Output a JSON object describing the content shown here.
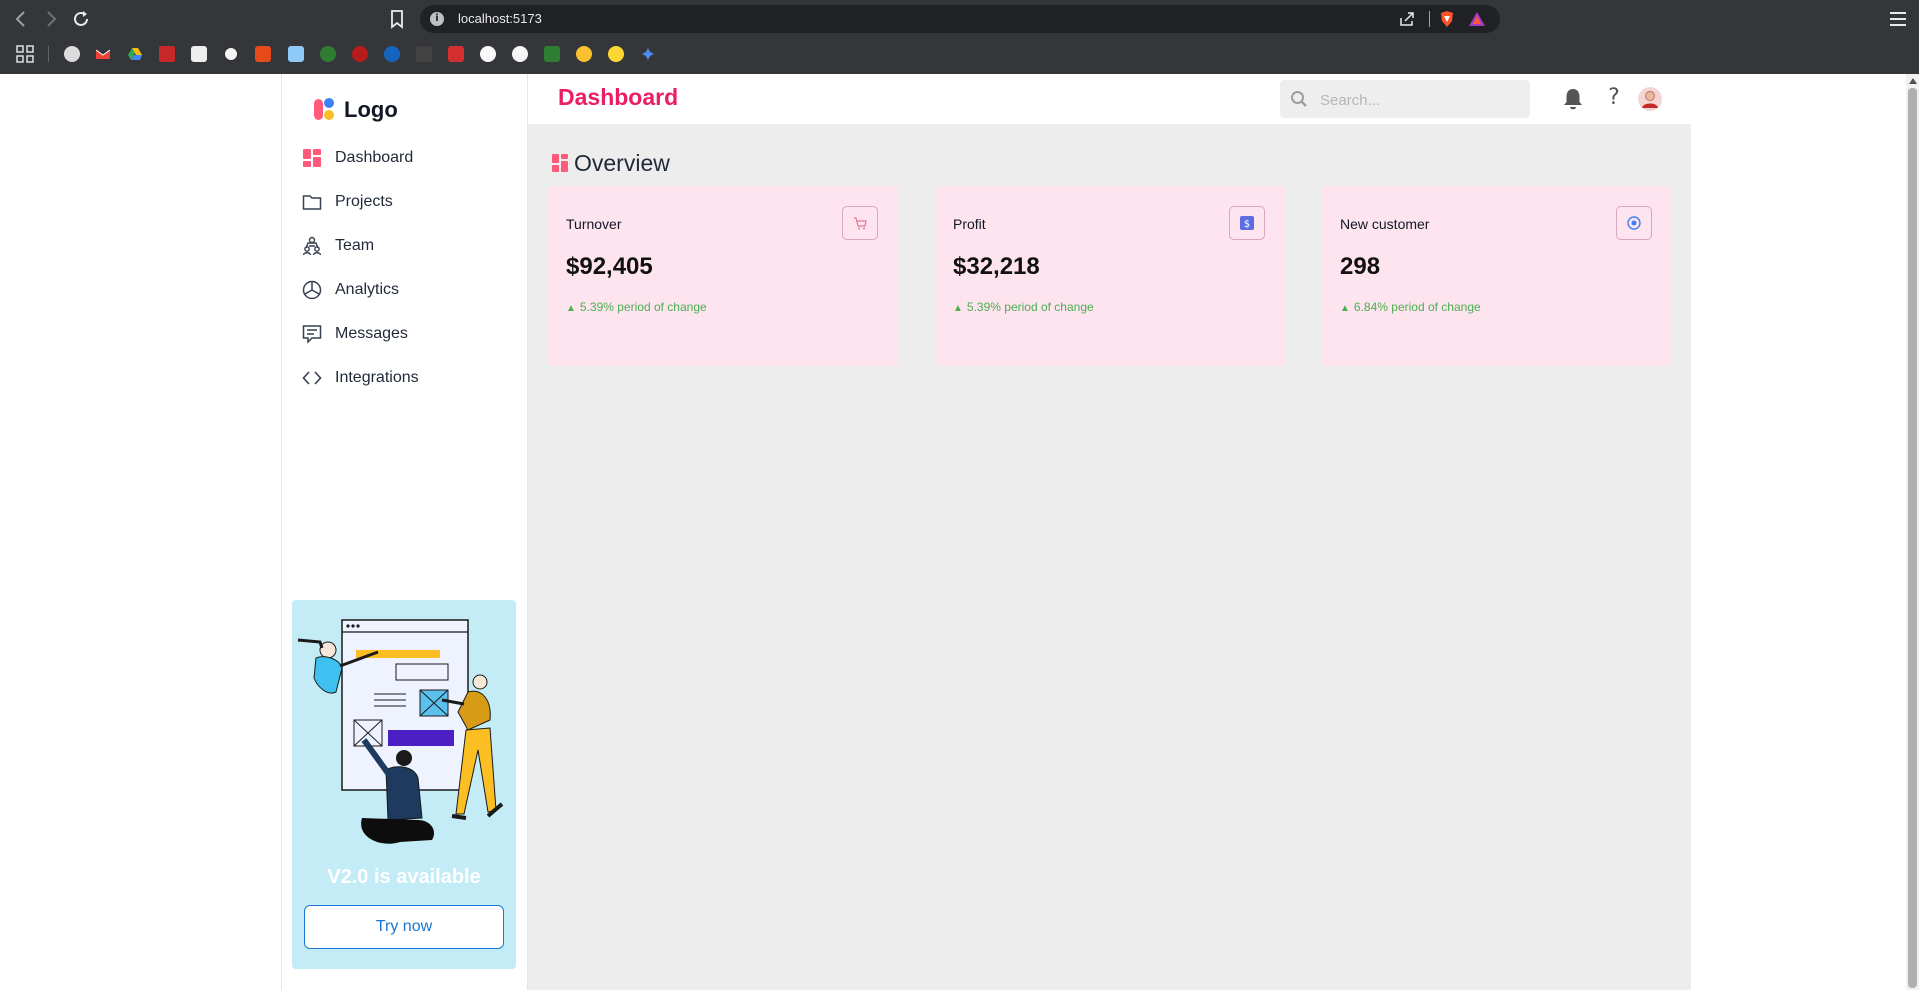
{
  "browser": {
    "url": "localhost:5173",
    "back_icon": "chevron-left-icon",
    "forward_icon": "chevron-right-icon",
    "reload_icon": "reload-icon"
  },
  "app": {
    "logo_text": "Logo",
    "page_title": "Dashboard",
    "search": {
      "placeholder": "Search..."
    },
    "help_label": "?",
    "sidebar": {
      "items": [
        {
          "label": "Dashboard",
          "icon": "dashboard-icon",
          "active": true
        },
        {
          "label": "Projects",
          "icon": "folder-icon"
        },
        {
          "label": "Team",
          "icon": "team-icon"
        },
        {
          "label": "Analytics",
          "icon": "pie-chart-icon"
        },
        {
          "label": "Messages",
          "icon": "message-icon"
        },
        {
          "label": "Integrations",
          "icon": "code-icon"
        }
      ],
      "promo": {
        "title": "V2.0 is available",
        "button": "Try now"
      }
    },
    "overview": {
      "title": "Overview",
      "cards": [
        {
          "label": "Turnover",
          "value": "$92,405",
          "change": "5.39% period of change",
          "icon": "cart-icon"
        },
        {
          "label": "Profit",
          "value": "$32,218",
          "change": "5.39% period of change",
          "icon": "dollar-icon"
        },
        {
          "label": "New customer",
          "value": "298",
          "change": "6.84% period of change",
          "icon": "customer-icon"
        }
      ]
    },
    "colors": {
      "accent": "#e91e63",
      "card_bg": "#fde4ee",
      "positive": "#4caf50",
      "promo_bg": "#c4ecf7",
      "button": "#1976d2"
    }
  }
}
